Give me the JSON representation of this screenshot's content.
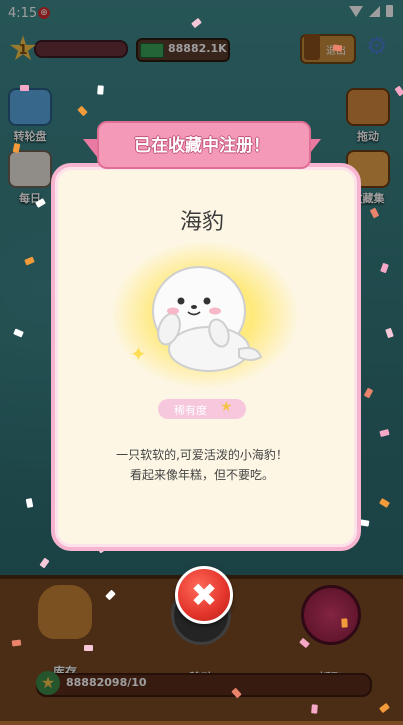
{
  "status_bar": {
    "time": "4:15",
    "app_icon_glyph": "⊕"
  },
  "hud": {
    "level": "1",
    "cash": "88882.1K",
    "exit_label": "退出"
  },
  "side_buttons": [
    {
      "label": "转轮盘"
    },
    {
      "label": "每日"
    },
    {
      "label": "拖动"
    },
    {
      "label": "收藏集"
    }
  ],
  "bottom_bar": {
    "buttons": [
      {
        "label": "库存"
      },
      {
        "label": "移动"
      },
      {
        "label": "抓取"
      }
    ],
    "progress_text": "88882098/10"
  },
  "modal": {
    "ribbon_title": "已在收藏中注册！",
    "animal_name": "海豹",
    "rarity_label": "稀有度",
    "rarity_stars": 1,
    "description_line1": "一只软软的,可爱活泼的小海豹！",
    "description_line2": "看起来像年糕，但不要吃。"
  },
  "colors": {
    "ribbon": "#f49ab8",
    "card_border": "#f7b4cf",
    "card_bg": "#fdf6e4",
    "close_button": "#e3342a"
  }
}
